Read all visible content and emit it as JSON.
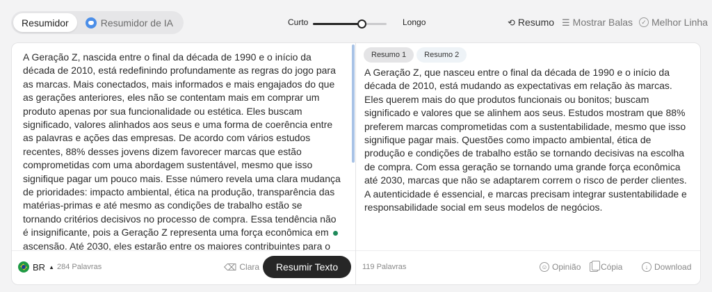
{
  "modes": {
    "summarizer_label": "Resumidor",
    "ai_summarizer_label": "Resumidor de IA"
  },
  "length": {
    "short_label": "Curto",
    "long_label": "Longo",
    "level": 0.66
  },
  "top_actions": {
    "summary_label": "Resumo",
    "show_bullets_label": "Mostrar Balas",
    "best_line_label": "Melhor Linha"
  },
  "input": {
    "text": "A Geração Z, nascida entre o final da década de 1990 e o início da década de 2010, está redefinindo profundamente as regras do jogo para as marcas. Mais conectados, mais informados e mais engajados do que as gerações anteriores, eles não se contentam mais em comprar um produto apenas por sua funcionalidade ou estética. Eles buscam significado, valores alinhados aos seus e uma forma de coerência entre as palavras e ações das empresas. De acordo com vários estudos recentes, 88% desses jovens dizem favorecer marcas que estão comprometidas com uma abordagem sustentável, mesmo que isso signifique pagar um pouco mais. Esse número revela uma clara mudança de prioridades: impacto ambiental, ética na produção, transparência das matérias-primas e até mesmo as condições de trabalho estão se tornando critérios decisivos no processo de compra. Essa tendência não é insignificante, pois a Geração Z representa uma força econômica em ascensão. Até 2030, eles estarão entre os maiores contribuintes para o poder de compra global. Marcas que não adaptam suas estratégias para atender às expectativas dessa geração",
    "language": "BR",
    "word_count": "284 Palavras",
    "clear_label": "Clara",
    "submit_label": "Resumir Texto"
  },
  "output": {
    "tabs": [
      "Resumo 1",
      "Resumo 2"
    ],
    "text": "A Geração Z, que nasceu entre o final da década de 1990 e o início da década de 2010, está mudando as expectativas em relação às marcas. Eles querem mais do que produtos funcionais ou bonitos; buscam significado e valores que se alinhem aos seus. Estudos mostram que 88% preferem marcas comprometidas com a sustentabilidade, mesmo que isso signifique pagar mais. Questões como impacto ambiental, ética de produção e condições de trabalho estão se tornando decisivas na escolha de compra. Com essa geração se tornando uma grande força econômica até 2030, marcas que não se adaptarem correm o risco de perder clientes. A autenticidade é essencial, e marcas precisam integrar sustentabilidade e responsabilidade social em seus modelos de negócios.",
    "word_count": "119 Palavras",
    "opinion_label": "Opinião",
    "copy_label": "Cópia",
    "download_label": "Download"
  },
  "icons": {
    "ai": "ai-bot-icon",
    "summary": "refresh-summary-icon",
    "bullets": "list-icon",
    "best_line": "check-circle-icon",
    "flag": "brazil-flag-icon",
    "clear": "eraser-icon",
    "opinion": "smiley-icon",
    "copy": "copy-icon",
    "download": "download-icon"
  },
  "colors": {
    "primary_button": "#262626",
    "accent_blue": "#4b8ee8",
    "scroll_indicator": "#a9c3e6"
  }
}
